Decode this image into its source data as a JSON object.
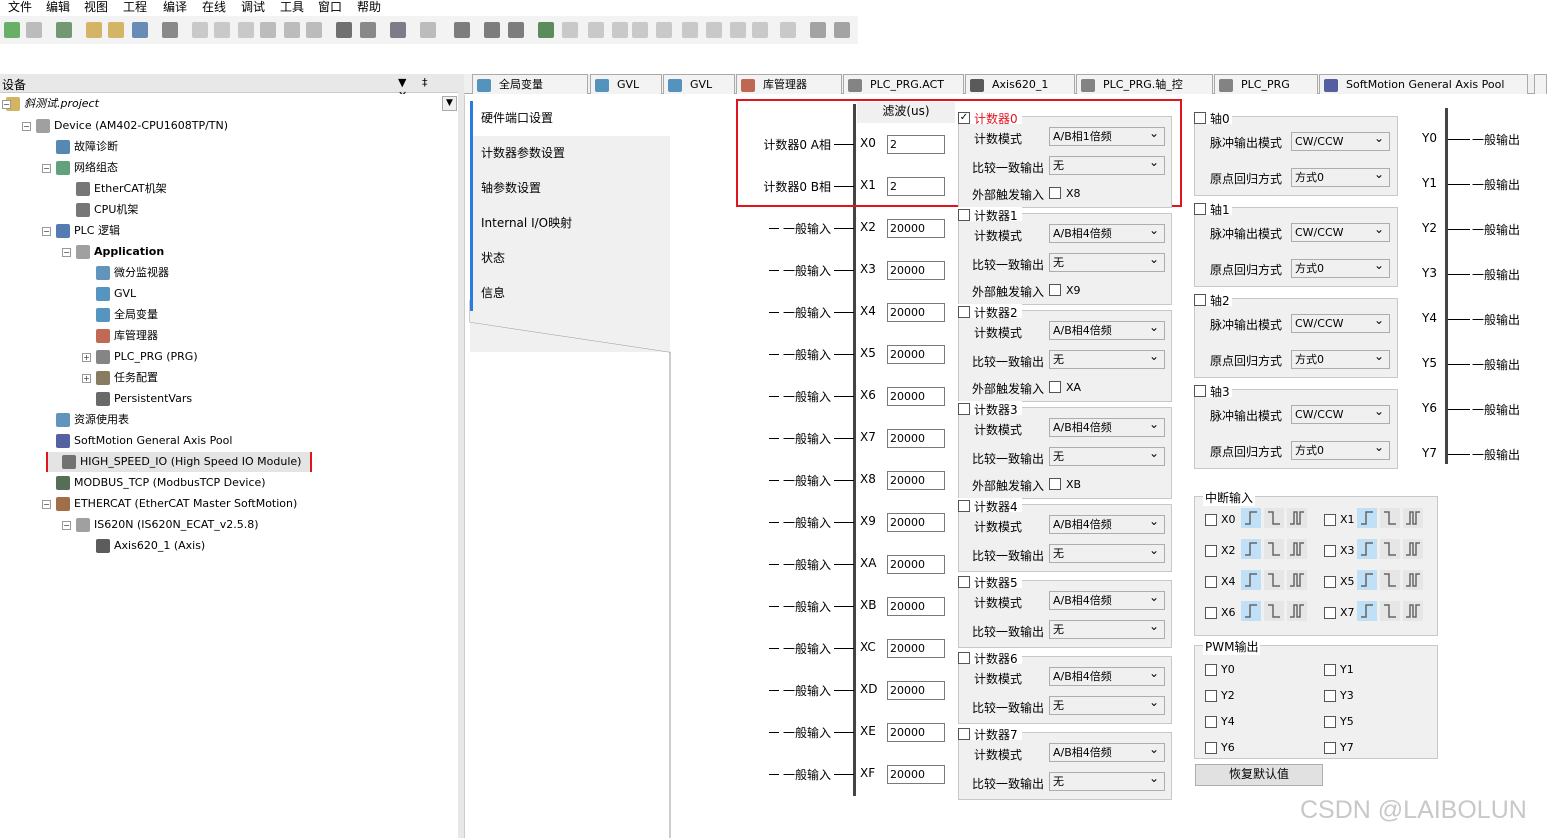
{
  "menu": [
    "文件",
    "编辑",
    "视图",
    "工程",
    "编译",
    "在线",
    "调试",
    "工具",
    "窗口",
    "帮助"
  ],
  "device_panel": {
    "title": "设备",
    "pin": "▼ ‡ ✕"
  },
  "tree": [
    {
      "label": "斜测试.project"
    },
    {
      "label": "Device (AM402-CPU1608TP/TN)"
    },
    {
      "label": "故障诊断"
    },
    {
      "label": "网络组态"
    },
    {
      "label": "EtherCAT机架"
    },
    {
      "label": "CPU机架"
    },
    {
      "label": "PLC 逻辑"
    },
    {
      "label": "Application"
    },
    {
      "label": "微分监视器"
    },
    {
      "label": "GVL"
    },
    {
      "label": "全局变量"
    },
    {
      "label": "库管理器"
    },
    {
      "label": "PLC_PRG (PRG)"
    },
    {
      "label": "任务配置"
    },
    {
      "label": "PersistentVars"
    },
    {
      "label": "资源使用表"
    },
    {
      "label": "SoftMotion General Axis Pool"
    },
    {
      "label": "HIGH_SPEED_IO (High Speed IO Module)"
    },
    {
      "label": "MODBUS_TCP (ModbusTCP Device)"
    },
    {
      "label": "ETHERCAT (EtherCAT Master SoftMotion)"
    },
    {
      "label": "IS620N (IS620N_ECAT_v2.5.8)"
    },
    {
      "label": "Axis620_1 (Axis)"
    }
  ],
  "tabs": [
    "全局变量",
    "GVL",
    "GVL",
    "库管理器",
    "PLC_PRG.ACT",
    "Axis620_1",
    "PLC_PRG.轴_控",
    "PLC_PRG",
    "SoftMotion General Axis Pool"
  ],
  "nav": [
    "硬件端口设置",
    "计数器参数设置",
    "轴参数设置",
    "Internal I/O映射",
    "状态",
    "信息"
  ],
  "filter_header": "滤波(us)",
  "inputs": [
    {
      "name": "X0",
      "desc": "计数器0 A相",
      "value": "2"
    },
    {
      "name": "X1",
      "desc": "计数器0 B相",
      "value": "2"
    },
    {
      "name": "X2",
      "desc": "一般输入",
      "value": "20000"
    },
    {
      "name": "X3",
      "desc": "一般输入",
      "value": "20000"
    },
    {
      "name": "X4",
      "desc": "一般输入",
      "value": "20000"
    },
    {
      "name": "X5",
      "desc": "一般输入",
      "value": "20000"
    },
    {
      "name": "X6",
      "desc": "一般输入",
      "value": "20000"
    },
    {
      "name": "X7",
      "desc": "一般输入",
      "value": "20000"
    },
    {
      "name": "X8",
      "desc": "一般输入",
      "value": "20000"
    },
    {
      "name": "X9",
      "desc": "一般输入",
      "value": "20000"
    },
    {
      "name": "XA",
      "desc": "一般输入",
      "value": "20000"
    },
    {
      "name": "XB",
      "desc": "一般输入",
      "value": "20000"
    },
    {
      "name": "XC",
      "desc": "一般输入",
      "value": "20000"
    },
    {
      "name": "XD",
      "desc": "一般输入",
      "value": "20000"
    },
    {
      "name": "XE",
      "desc": "一般输入",
      "value": "20000"
    },
    {
      "name": "XF",
      "desc": "一般输入",
      "value": "20000"
    }
  ],
  "counter_labels": {
    "mode": "计数模式",
    "compare": "比较一致输出",
    "ext": "外部触发输入"
  },
  "counters": [
    {
      "title": "计数器0",
      "checked": true,
      "mode": "A/B相1倍频",
      "compare": "无",
      "ext": "X8"
    },
    {
      "title": "计数器1",
      "checked": false,
      "mode": "A/B相4倍频",
      "compare": "无",
      "ext": "X9"
    },
    {
      "title": "计数器2",
      "checked": false,
      "mode": "A/B相4倍频",
      "compare": "无",
      "ext": "XA"
    },
    {
      "title": "计数器3",
      "checked": false,
      "mode": "A/B相4倍频",
      "compare": "无",
      "ext": "XB"
    },
    {
      "title": "计数器4",
      "checked": false,
      "mode": "A/B相4倍频",
      "compare": "无"
    },
    {
      "title": "计数器5",
      "checked": false,
      "mode": "A/B相4倍频",
      "compare": "无"
    },
    {
      "title": "计数器6",
      "checked": false,
      "mode": "A/B相4倍频",
      "compare": "无"
    },
    {
      "title": "计数器7",
      "checked": false,
      "mode": "A/B相4倍频",
      "compare": "无"
    }
  ],
  "axis_labels": {
    "pulse": "脉冲输出模式",
    "home": "原点回归方式"
  },
  "axes": [
    {
      "title": "轴0",
      "pulse": "CW/CCW",
      "home": "方式0"
    },
    {
      "title": "轴1",
      "pulse": "CW/CCW",
      "home": "方式0"
    },
    {
      "title": "轴2",
      "pulse": "CW/CCW",
      "home": "方式0"
    },
    {
      "title": "轴3",
      "pulse": "CW/CCW",
      "home": "方式0"
    }
  ],
  "outputs": [
    {
      "name": "Y0",
      "desc": "一般输出"
    },
    {
      "name": "Y1",
      "desc": "一般输出"
    },
    {
      "name": "Y2",
      "desc": "一般输出"
    },
    {
      "name": "Y3",
      "desc": "一般输出"
    },
    {
      "name": "Y4",
      "desc": "一般输出"
    },
    {
      "name": "Y5",
      "desc": "一般输出"
    },
    {
      "name": "Y6",
      "desc": "一般输出"
    },
    {
      "name": "Y7",
      "desc": "一般输出"
    }
  ],
  "interrupt": {
    "title": "中断输入",
    "items": [
      "X0",
      "X1",
      "X2",
      "X3",
      "X4",
      "X5",
      "X6",
      "X7"
    ]
  },
  "pwm": {
    "title": "PWM输出",
    "items": [
      "Y0",
      "Y1",
      "Y2",
      "Y3",
      "Y4",
      "Y5",
      "Y6",
      "Y7"
    ]
  },
  "restore_button": "恢复默认值",
  "watermark": "CSDN @LAIBOLUN",
  "colors": {
    "highlight_box": "#e0141e",
    "nav_accent": "#2a7ae2",
    "edge_on": "#bfe0f7"
  }
}
